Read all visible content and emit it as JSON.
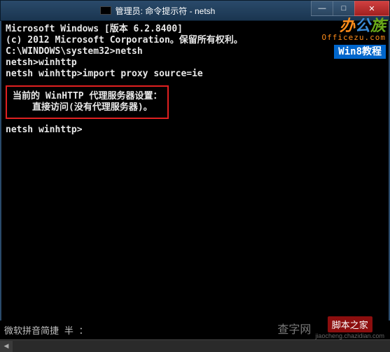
{
  "titlebar": {
    "title": "管理员: 命令提示符 - netsh",
    "min": "—",
    "max": "□",
    "close": "✕"
  },
  "terminal": {
    "line1": "Microsoft Windows [版本 6.2.8400]",
    "line2": "(c) 2012 Microsoft Corporation。保留所有权利。",
    "blank": " ",
    "prompt1": "C:\\WINDOWS\\system32>netsh",
    "prompt2": "netsh>winhttp",
    "prompt3": "netsh winhttp>import proxy source=ie",
    "box_line1": "当前的 WinHTTP 代理服务器设置：",
    "box_line2": "直接访问(没有代理服务器)。",
    "prompt4": "netsh winhttp>"
  },
  "watermark": {
    "brand1": "办",
    "brand2": "公",
    "brand3": "族",
    "url": "Officezu.com",
    "tag": "Win8教程"
  },
  "ime": "微软拼音简捷 半 ：",
  "scrollbar": {
    "left": "◀"
  },
  "bottom_wm": {
    "text": "查字网",
    "red": "脚本之家",
    "url": "jiaocheng.chazidian.com"
  }
}
